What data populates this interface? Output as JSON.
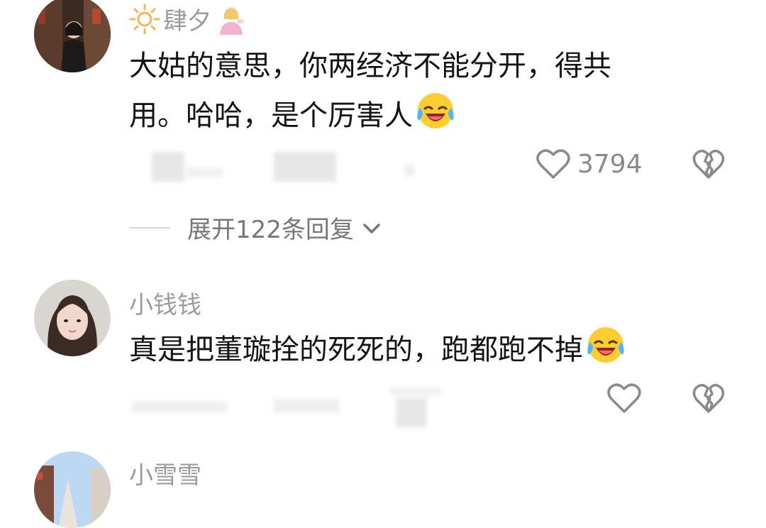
{
  "comments": [
    {
      "username": "肆夕",
      "text_line1": "大姑的意思，你两经济不能分开，得共",
      "text_line2": "用。哈哈，是个厉害人",
      "likes": "3794",
      "expand_label": "展开122条回复"
    },
    {
      "username": "小钱钱",
      "text": "真是把董璇拴的死死的，跑都跑不掉"
    },
    {
      "username": "小雪雪"
    }
  ],
  "icons": {
    "prefix_badge": "sun-icon",
    "suffix_badge": "person-emoji-icon",
    "laugh": "laughing-crying-emoji-icon",
    "like": "heart-outline-icon",
    "dislike": "broken-heart-icon",
    "chevron": "chevron-down-icon"
  },
  "colors": {
    "username": "#9b9b9b",
    "text": "#141414",
    "icon": "#8a8a8a",
    "sun": "#f7b45a"
  }
}
